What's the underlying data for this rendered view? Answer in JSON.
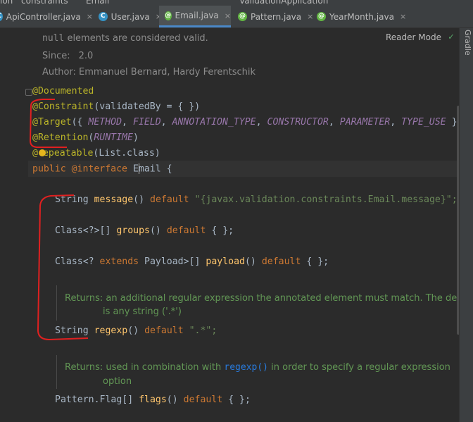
{
  "top_strip": {
    "left_fragment": "ion",
    "path_fragment": "constraints",
    "file_fragment": "Email",
    "run_config": "ValidationApplication"
  },
  "tabs": [
    {
      "label": "ApiController.java",
      "icon": "class-icon",
      "icon_letter": "C",
      "icon_color": "#3592c4",
      "active": false
    },
    {
      "label": "User.java",
      "icon": "class-icon",
      "icon_letter": "C",
      "icon_color": "#3592c4",
      "active": false
    },
    {
      "label": "Email.java",
      "icon": "annotation-icon",
      "icon_letter": "@",
      "icon_color": "#62b543",
      "active": true
    },
    {
      "label": "Pattern.java",
      "icon": "annotation-icon",
      "icon_letter": "@",
      "icon_color": "#62b543",
      "active": false
    },
    {
      "label": "YearMonth.java",
      "icon": "annotation-icon",
      "icon_letter": "@",
      "icon_color": "#62b543",
      "active": false
    }
  ],
  "close_glyph": "×",
  "right_panel": {
    "gradle_label": "Gradle"
  },
  "doc_header": {
    "null_code": "null",
    "null_text": " elements are considered valid.",
    "since_label": "Since:",
    "since_value": "2.0",
    "author_line": "Author: Emmanuel Bernard, Hardy Ferentschik",
    "reader_mode": "Reader Mode"
  },
  "code": {
    "documented": "@Documented",
    "constraint_ann": "@Constraint",
    "constraint_rest": "(validatedBy = { })",
    "target_ann": "@Target",
    "target_open": "({ ",
    "target_values": [
      "METHOD",
      "FIELD",
      "ANNOTATION_TYPE",
      "CONSTRUCTOR",
      "PARAMETER",
      "TYPE_USE"
    ],
    "target_close": " })",
    "retention_ann": "@Retention",
    "retention_value": "RUNTIME",
    "repeatable_at": "@",
    "repeatable_rest": "epeatable",
    "repeatable_args": "(List.class)",
    "decl_public": "public",
    "decl_interface": "@interface",
    "decl_name_first": "E",
    "decl_name_rest": "mail",
    "decl_brace": " {",
    "message_type": "String ",
    "message_name": "message",
    "message_default": "default",
    "message_value": "\"{javax.validation.constraints.Email.message}\";",
    "groups_type": "Class<?>[] ",
    "groups_name": "groups",
    "groups_default": "default",
    "groups_value": " { };",
    "payload_type_a": "Class<? ",
    "payload_extends": "extends",
    "payload_type_b": " Payload>[] ",
    "payload_name": "payload",
    "payload_default": "default",
    "payload_value": " { };",
    "regexp_doc_line1": "Returns: an additional regular expression the annotated element must match. The default",
    "regexp_doc_line2": "is any string ('.*')",
    "regexp_type": "String ",
    "regexp_name": "regexp",
    "regexp_default": "default",
    "regexp_value": "\".*\";",
    "flags_doc_prefix": "Returns: used in combination with ",
    "flags_doc_link": "regexp()",
    "flags_doc_suffix": " in order to specify a regular expression",
    "flags_doc_line2": "option",
    "flags_type": "Pattern.Flag[] ",
    "flags_name": "flags",
    "flags_default": "default",
    "flags_value": " { };",
    "parens": "()"
  },
  "colors": {
    "annotation": "#bbb529",
    "keyword": "#cc7832",
    "enum_constant": "#9876aa",
    "string": "#6a8759",
    "method": "#ffc66d",
    "doc_rendered": "#629755",
    "link": "#287bde",
    "red_markup": "#e02020"
  }
}
